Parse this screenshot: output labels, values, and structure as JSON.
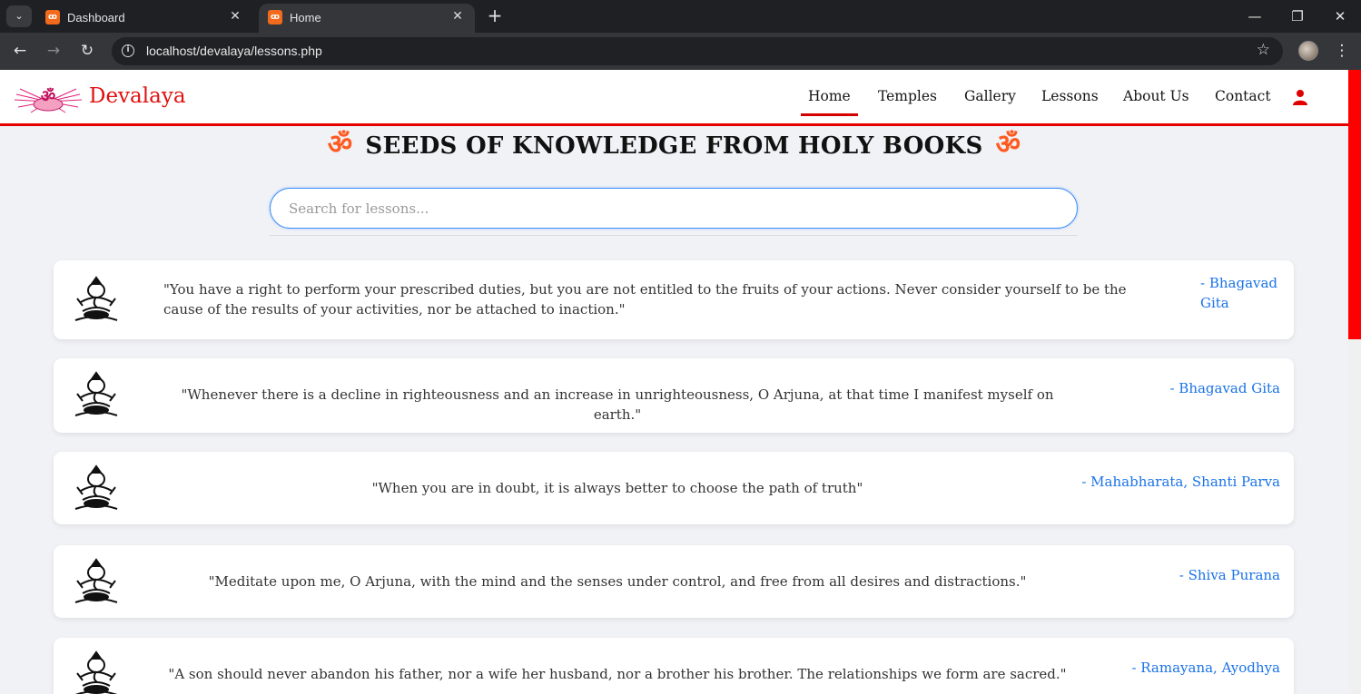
{
  "browser": {
    "tabs": [
      {
        "title": "Dashboard",
        "active": false
      },
      {
        "title": "Home",
        "active": true
      }
    ],
    "url": "localhost/devalaya/lessons.php"
  },
  "site": {
    "brand": "Devalaya",
    "nav": [
      "Home",
      "Temples",
      "Gallery",
      "Lessons",
      "About Us",
      "Contact"
    ],
    "active_nav": "Home",
    "accent_color": "#e01010"
  },
  "page": {
    "heading": "SEEDS OF KNOWLEDGE FROM HOLY BOOKS",
    "om_symbol": "ॐ",
    "search_placeholder": "Search for lessons..."
  },
  "lessons": [
    {
      "quote": "\"You have a right to perform your prescribed duties, but you are not entitled to the fruits of your actions. Never consider yourself to be the cause of the results of your activities, nor be attached to inaction.\"",
      "source": "- Bhagavad Gita"
    },
    {
      "quote": "\"Whenever there is a decline in righteousness and an increase in unrighteousness, O Arjuna, at that time I manifest myself on earth.\"",
      "source": "- Bhagavad Gita"
    },
    {
      "quote": "\"When you are in doubt, it is always better to choose the path of truth\"",
      "source": "- Mahabharata, Shanti Parva"
    },
    {
      "quote": "\"Meditate upon me, O Arjuna, with the mind and the senses under control, and free from all desires and distractions.\"",
      "source": "- Shiva Purana"
    },
    {
      "quote": "\"A son should never abandon his father, nor a wife her husband, nor a brother his brother. The relationships we form are sacred.\"",
      "source": "- Ramayana, Ayodhya"
    }
  ]
}
